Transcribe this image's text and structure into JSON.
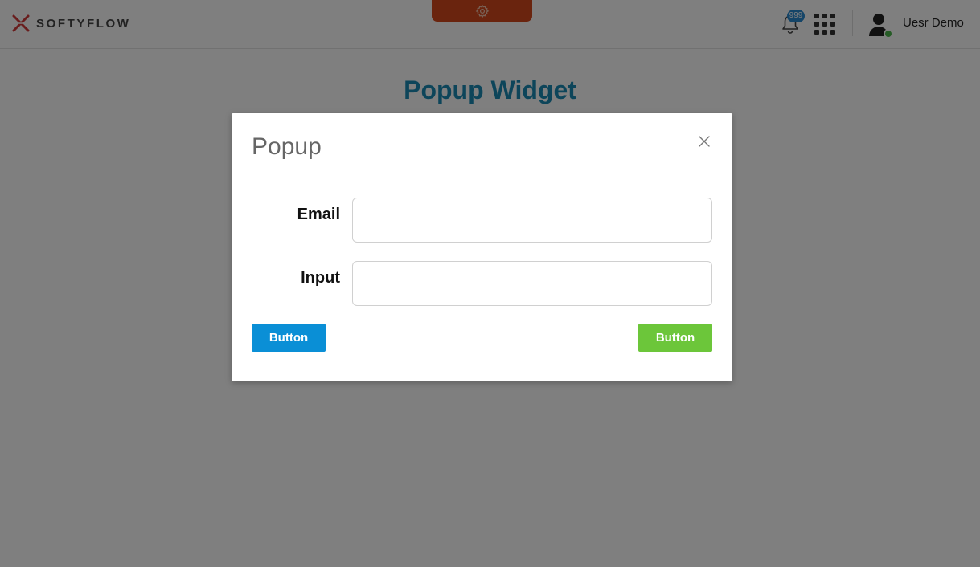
{
  "header": {
    "logo_text": "SOFTYFLOW",
    "notification_count": "999",
    "user_name": "Uesr Demo",
    "icons": [
      "logo-icon",
      "settings-icon",
      "bell-icon",
      "apps-grid-icon",
      "user-avatar-icon"
    ]
  },
  "page": {
    "title": "Popup Widget"
  },
  "modal": {
    "title": "Popup",
    "fields": [
      {
        "label": "Email",
        "value": "",
        "placeholder": ""
      },
      {
        "label": "Input",
        "value": "",
        "placeholder": ""
      }
    ],
    "buttons": {
      "primary_label": "Button",
      "secondary_label": "Button"
    }
  },
  "colors": {
    "brand_red": "#d5481c",
    "title_blue": "#1a8ab5",
    "button_blue": "#0a8fd6",
    "button_green": "#6cc63a",
    "online_green": "#4cb84c"
  }
}
